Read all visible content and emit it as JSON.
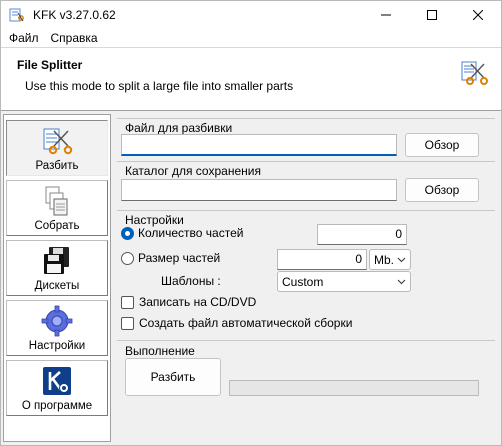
{
  "window": {
    "title": "KFK v3.27.0.62"
  },
  "menu": {
    "items": [
      "Файл",
      "Справка"
    ]
  },
  "header": {
    "title": "File Splitter",
    "subtitle": "Use this mode to split a large file into smaller parts",
    "icon": "scissors-icon"
  },
  "sidebar": {
    "items": [
      {
        "label": "Разбить",
        "icon": "split-icon",
        "active": true
      },
      {
        "label": "Собрать",
        "icon": "join-icon",
        "active": false
      },
      {
        "label": "Дискеты",
        "icon": "floppy-icon",
        "active": false
      },
      {
        "label": "Настройки",
        "icon": "gear-icon",
        "active": false
      },
      {
        "label": "О программе",
        "icon": "about-icon",
        "active": false
      }
    ]
  },
  "source": {
    "group_label": "Файл для разбивки",
    "value": "",
    "browse_label": "Обзор"
  },
  "target": {
    "group_label": "Каталог для сохранения",
    "value": "",
    "browse_label": "Обзор"
  },
  "settings": {
    "group_label": "Настройки",
    "parts_count_label": "Количество частей",
    "parts_count_value": "0",
    "parts_count_selected": true,
    "part_size_label": "Размер частей",
    "part_size_value": "0",
    "part_size_unit": "Mb.",
    "templates_label": "Шаблоны :",
    "templates_value": "Custom",
    "burn_label": "Записать на CD/DVD",
    "burn_checked": false,
    "autojoin_label": "Создать файл автоматической сборки",
    "autojoin_checked": false
  },
  "execution": {
    "group_label": "Выполнение",
    "run_label": "Разбить",
    "progress": 0
  },
  "colors": {
    "accent": "#005fb8",
    "progress_fill": "#06b025"
  }
}
